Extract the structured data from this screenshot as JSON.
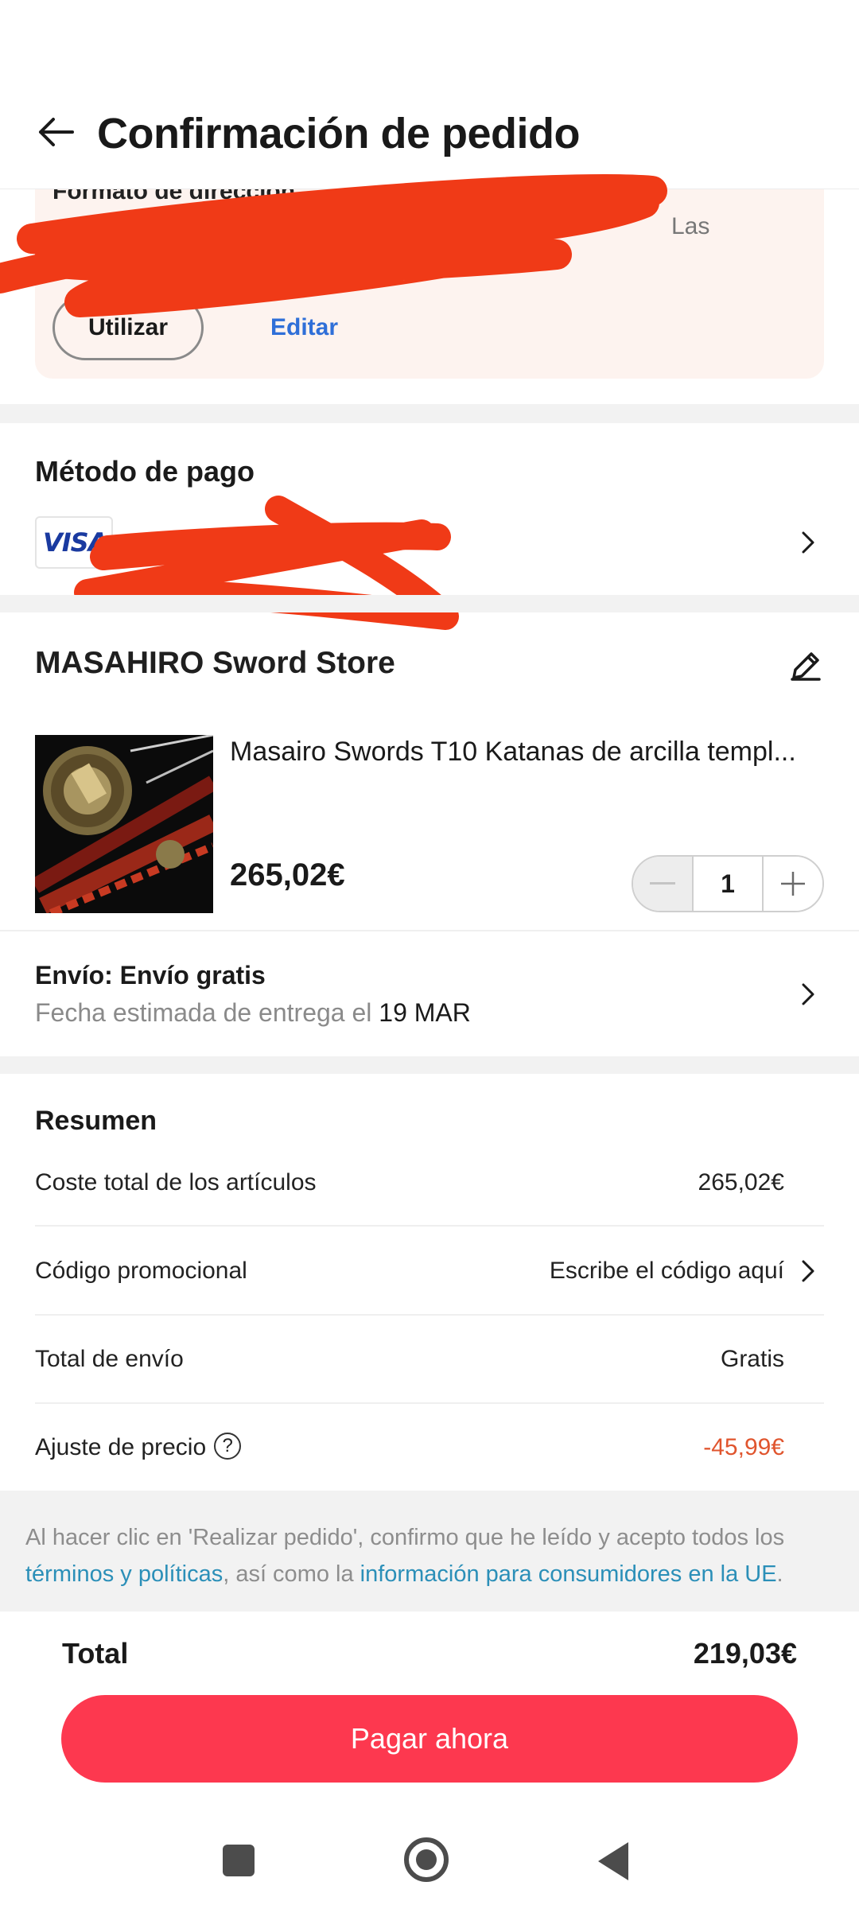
{
  "header": {
    "title": "Confirmación de pedido"
  },
  "address": {
    "line1": "Formato de dirección",
    "line2": "Las",
    "use_label": "Utilizar",
    "edit_label": "Editar"
  },
  "payment": {
    "title": "Método de pago",
    "card_brand": "VISA",
    "card_masked": ""
  },
  "store": {
    "name": "MASAHIRO Sword Store",
    "product": {
      "title": "Masairo Swords T10 Katanas de arcilla templ...",
      "price": "265,02€",
      "quantity": "1"
    }
  },
  "shipping": {
    "title": "Envío: Envío gratis",
    "date_prefix": "Fecha estimada de entrega el ",
    "date": "19 MAR"
  },
  "summary": {
    "title": "Resumen",
    "rows": [
      {
        "label": "Coste total de los artículos",
        "value": "265,02€"
      },
      {
        "label": "Código promocional",
        "value": "Escribe el código aquí"
      },
      {
        "label": "Total de envío",
        "value": "Gratis"
      },
      {
        "label": "Ajuste de precio",
        "value": "-45,99€"
      }
    ]
  },
  "disclaimer": {
    "part1": "Al hacer clic en 'Realizar pedido', confirmo que he leído y acepto todos los ",
    "link1": "términos y políticas",
    "part2": ", así como la ",
    "link2": "información para consumidores en la UE",
    "part3": "."
  },
  "footer": {
    "total_label": "Total",
    "total_value": "219,03€",
    "pay_label": "Pagar ahora"
  },
  "colors": {
    "accent": "#fd384f",
    "link": "#2b8fb8",
    "edit_link": "#2f6fd8",
    "discount": "#e0552e",
    "address_bg": "#fdf3ef",
    "redaction": "#f03a17"
  }
}
